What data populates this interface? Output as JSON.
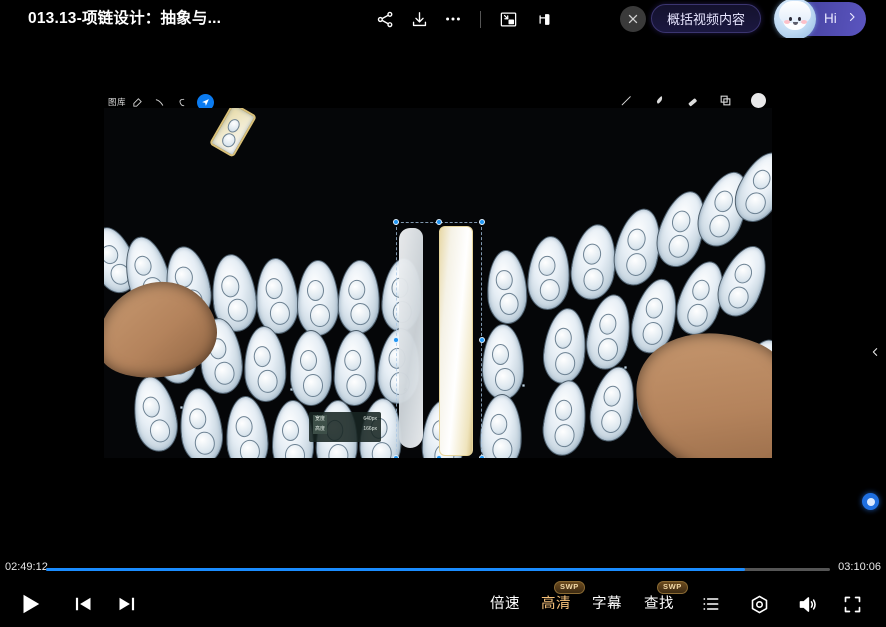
{
  "window": {
    "title": "013.13-项链设计：抽象与...",
    "background_color": "#000000"
  },
  "topbar": {
    "icons": [
      {
        "name": "share-icon",
        "label": "分享"
      },
      {
        "name": "download-icon",
        "label": "下载"
      },
      {
        "name": "more-icon",
        "label": "更多"
      },
      {
        "name": "picture-in-picture-icon",
        "label": "小窗播放"
      },
      {
        "name": "cast-icon",
        "label": "投屏"
      }
    ],
    "close_label": "×",
    "summarize_label": "概括视频内容",
    "user": {
      "greeting": "Hi",
      "chevron": "›",
      "avatar_name": "astronaut-avatar",
      "pill_color": "#4b47a8"
    }
  },
  "video": {
    "procreate_gallery_label": "图库",
    "tools": [
      "adjust-icon",
      "selection-icon",
      "transform-icon"
    ],
    "active_tool": "transform-icon",
    "right_tools": [
      "brush-icon",
      "smudge-icon",
      "eraser-icon",
      "layers-icon",
      "color-swatch"
    ],
    "tooltip": {
      "width_label": "宽度",
      "width_value": "640px",
      "height_label": "高度",
      "height_value": "166px"
    }
  },
  "side": {
    "collapse_chevron": "‹",
    "floating_badge_name": "assistant-bubble"
  },
  "player": {
    "current_time": "02:49:12",
    "total_time": "03:10:06",
    "progress_percent": 89,
    "buffered_percent": 89,
    "accent_color": "#1a8cff",
    "track_color": "#555555",
    "controls": {
      "play_label": "播放",
      "prev_label": "上一个",
      "next_label": "下一个"
    },
    "text_buttons": [
      {
        "name": "speed-button",
        "label": "倍速",
        "badge": null,
        "highlight": false
      },
      {
        "name": "quality-button",
        "label": "高清",
        "badge": "SWP",
        "highlight": true
      },
      {
        "name": "subtitle-button",
        "label": "字幕",
        "badge": null,
        "highlight": false
      },
      {
        "name": "search-button",
        "label": "查找",
        "badge": "SWP",
        "highlight": false
      }
    ],
    "icon_buttons": [
      {
        "name": "playlist-icon",
        "label": "选集"
      },
      {
        "name": "settings-icon",
        "label": "设置"
      },
      {
        "name": "volume-icon",
        "label": "音量"
      },
      {
        "name": "fullscreen-icon",
        "label": "全屏"
      }
    ]
  }
}
